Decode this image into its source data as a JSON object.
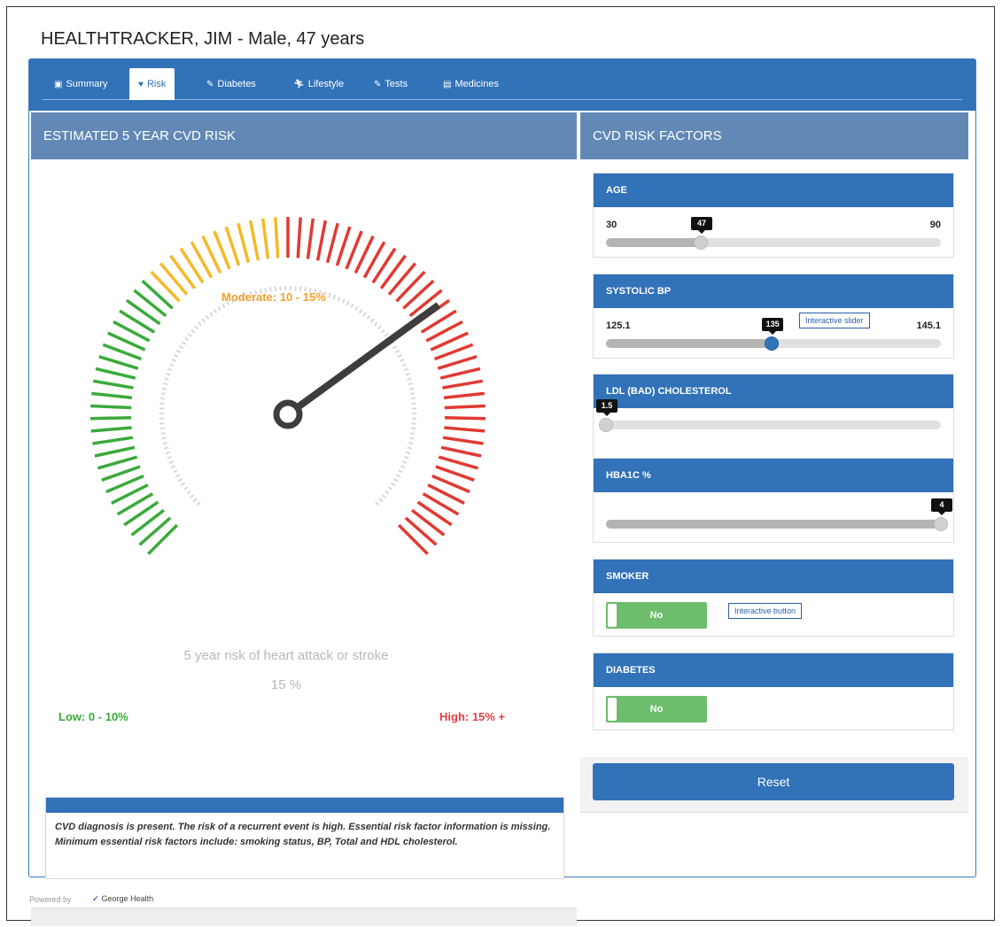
{
  "header": {
    "title": "HEALTHTRACKER, JIM - Male, 47 years"
  },
  "tabs": [
    {
      "label": "Summary",
      "icon": "clipboard-icon",
      "active": false
    },
    {
      "label": "Risk",
      "icon": "heart-icon",
      "active": true
    },
    {
      "label": "Diabetes",
      "icon": "pencil-icon",
      "active": false
    },
    {
      "label": "Lifestyle",
      "icon": "running-person-icon",
      "active": false
    },
    {
      "label": "Tests",
      "icon": "pencil-icon",
      "active": false
    },
    {
      "label": "Medicines",
      "icon": "medicine-bottle-icon",
      "active": false
    }
  ],
  "risk_panel": {
    "title": "ESTIMATED 5 YEAR CVD RISK",
    "moderate_label": "Moderate: 10 - 15%",
    "low_label": "Low: 0 - 10%",
    "high_label": "High: 15% +",
    "caption": "5 year risk of heart attack or stroke",
    "value_text": "15 %",
    "gauge": {
      "max_percent": 30,
      "needle_percent": 21,
      "colors": {
        "low": "#3aaa3a",
        "moderate": "#f5b928",
        "high": "#e03a32",
        "needle": "#3d3d3d"
      }
    },
    "notice": "CVD diagnosis is present. The risk of a recurrent event is high. Essential risk factor information is missing. Minimum essential risk factors include: smoking status, BP, Total and HDL cholesterol."
  },
  "factors_panel": {
    "title": "CVD RISK FACTORS",
    "age": {
      "label": "AGE",
      "min": "30",
      "max": "90",
      "value": "47",
      "fraction": 0.283
    },
    "systolic_bp": {
      "label": "SYSTOLIC BP",
      "min": "125.1",
      "max": "145.1",
      "value": "135",
      "fraction": 0.495,
      "annotation": "Interactive slider"
    },
    "ldl": {
      "label": "LDL (BAD) CHOLESTEROL",
      "value": "1.5",
      "fraction": 0.0
    },
    "hba1c": {
      "label": "HBA1C %",
      "value": "4",
      "fraction": 1.0
    },
    "smoker": {
      "label": "SMOKER",
      "value": "No",
      "annotation": "Interactive button"
    },
    "diabetes": {
      "label": "DIABETES",
      "value": "No"
    },
    "reset_label": "Reset"
  },
  "footer": {
    "powered_by": "Powered by",
    "brand": "George Health"
  },
  "colors": {
    "brand_blue": "#3272b8",
    "header_slate": "#6289b6"
  }
}
